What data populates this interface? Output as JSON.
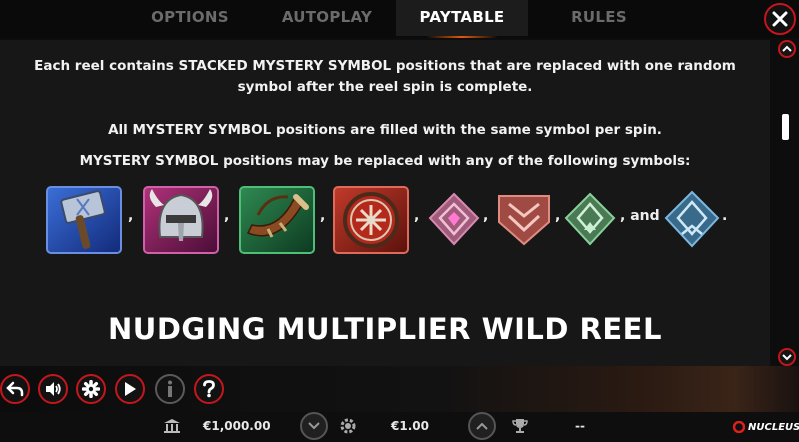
{
  "tabs": [
    {
      "label": "OPTIONS",
      "active": false
    },
    {
      "label": "AUTOPLAY",
      "active": false
    },
    {
      "label": "PAYTABLE",
      "active": true
    },
    {
      "label": "RULES",
      "active": false
    }
  ],
  "content": {
    "para1_line1": "Each reel contains STACKED MYSTERY SYMBOL positions that are replaced with one random",
    "para1_line2": "symbol after the reel spin is complete.",
    "para2": "All MYSTERY SYMBOL positions are filled with the same symbol per spin.",
    "para3": "MYSTERY SYMBOL positions may be replaced with any of the following symbols:",
    "symbols": [
      "hammer-symbol",
      "helmet-symbol",
      "horn-symbol",
      "shield-symbol",
      "pink-rune-symbol",
      "red-rune-symbol",
      "green-rune-symbol",
      "blue-rune-symbol"
    ],
    "separator": ",",
    "and_text": ", and",
    "end_text": ".",
    "heading": "NUDGING MULTIPLIER WILD REEL"
  },
  "toolbar": {
    "buttons": [
      "back-arrow-icon",
      "sound-icon",
      "settings-gear-icon",
      "play-icon",
      "info-icon",
      "help-question-icon"
    ]
  },
  "footer": {
    "balance": "€1,000.00",
    "bet": "€1.00",
    "win": "--",
    "logo": "NUCLEUS"
  },
  "colors": {
    "accent_red": "#c4161c",
    "background": "#171717",
    "inactive_tab": "#6b6b6b"
  }
}
